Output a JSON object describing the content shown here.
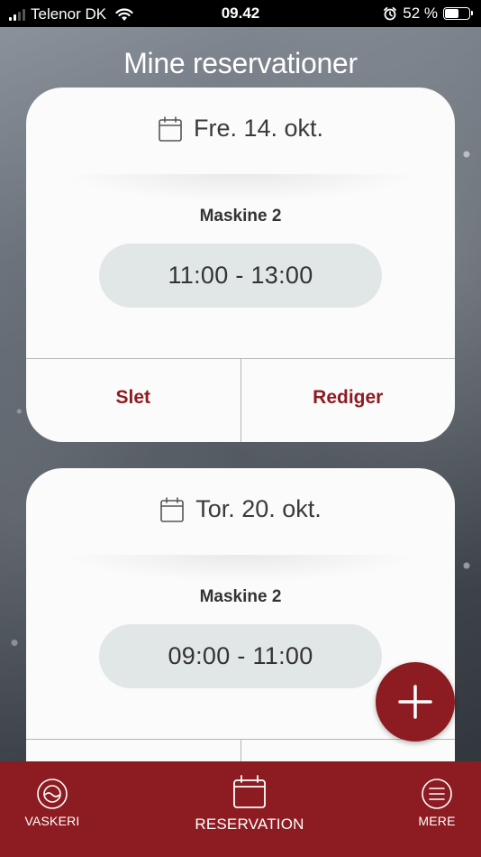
{
  "status_bar": {
    "carrier": "Telenor DK",
    "time": "09.42",
    "battery": "52 %",
    "battery_level": 0.52
  },
  "page_title": "Mine reservationer",
  "reservations": [
    {
      "date": "Fre. 14. okt.",
      "machine": "Maskine 2",
      "time": "11:00 - 13:00",
      "delete_label": "Slet",
      "edit_label": "Rediger"
    },
    {
      "date": "Tor. 20. okt.",
      "machine": "Maskine 2",
      "time": "09:00 - 11:00"
    }
  ],
  "fab": {
    "icon": "plus-icon"
  },
  "bottom_nav": {
    "items": [
      {
        "label": "VASKERI",
        "icon": "washing-machine-icon"
      },
      {
        "label": "RESERVATION",
        "icon": "calendar-icon"
      },
      {
        "label": "MERE",
        "icon": "menu-icon"
      }
    ]
  },
  "colors": {
    "brand": "#8c1c22",
    "card": "#fafbfa",
    "pill": "#e1e6e6"
  }
}
